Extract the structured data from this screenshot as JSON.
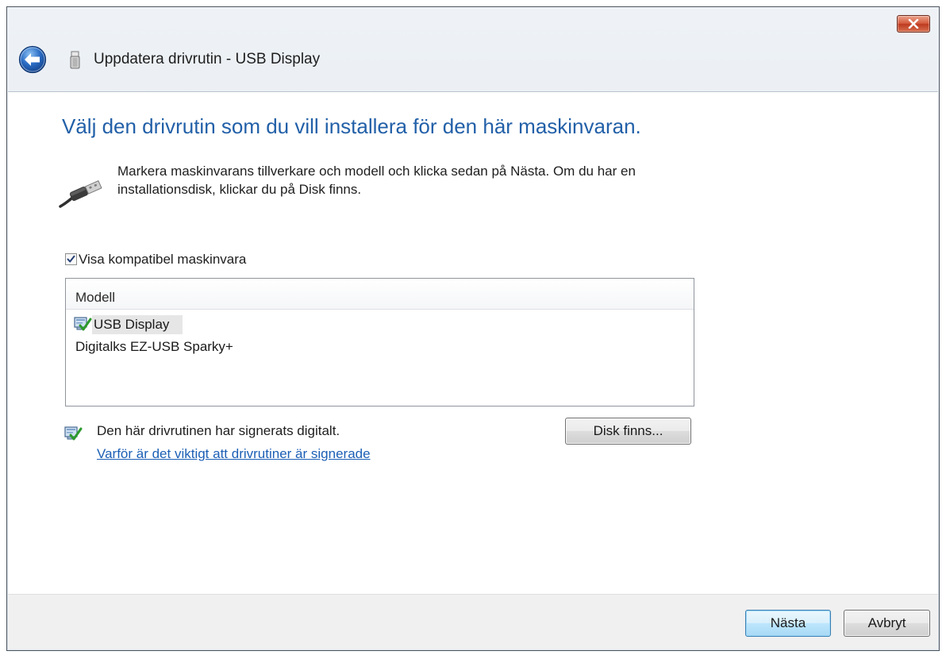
{
  "window": {
    "title": "Uppdatera drivrutin - USB Display",
    "close_icon": "close-icon",
    "back_icon": "back-arrow-icon",
    "device_icon": "usb-device-icon"
  },
  "heading": "Välj den drivrutin som du vill installera för den här maskinvaran.",
  "instructions": {
    "icon": "usb-cable-icon",
    "lines": [
      "Markera maskinvarans tillverkare och modell och klicka sedan på Nästa. Om du har en",
      "installationsdisk, klickar du på Disk finns."
    ]
  },
  "compatible_checkbox": {
    "label": "Visa kompatibel maskinvara",
    "checked": true
  },
  "model_list": {
    "header": "Modell",
    "items": [
      {
        "label": "USB Display",
        "icon": "signed-driver-icon",
        "selected": true
      },
      {
        "label": "Digitalks EZ-USB Sparky+"
      }
    ]
  },
  "signature": {
    "icon": "signed-driver-icon",
    "text": "Den här drivrutinen har signerats digitalt.",
    "link": "Varför är det viktigt att drivrutiner är signerade"
  },
  "buttons": {
    "have_disk": "Disk finns...",
    "next": "Nästa",
    "cancel": "Avbryt"
  },
  "colors": {
    "heading": "#2260a8",
    "link": "#1c5fb5",
    "back_button": "#2a6cc4",
    "close_button": "#c8482d",
    "check": "#2c9a2c"
  }
}
